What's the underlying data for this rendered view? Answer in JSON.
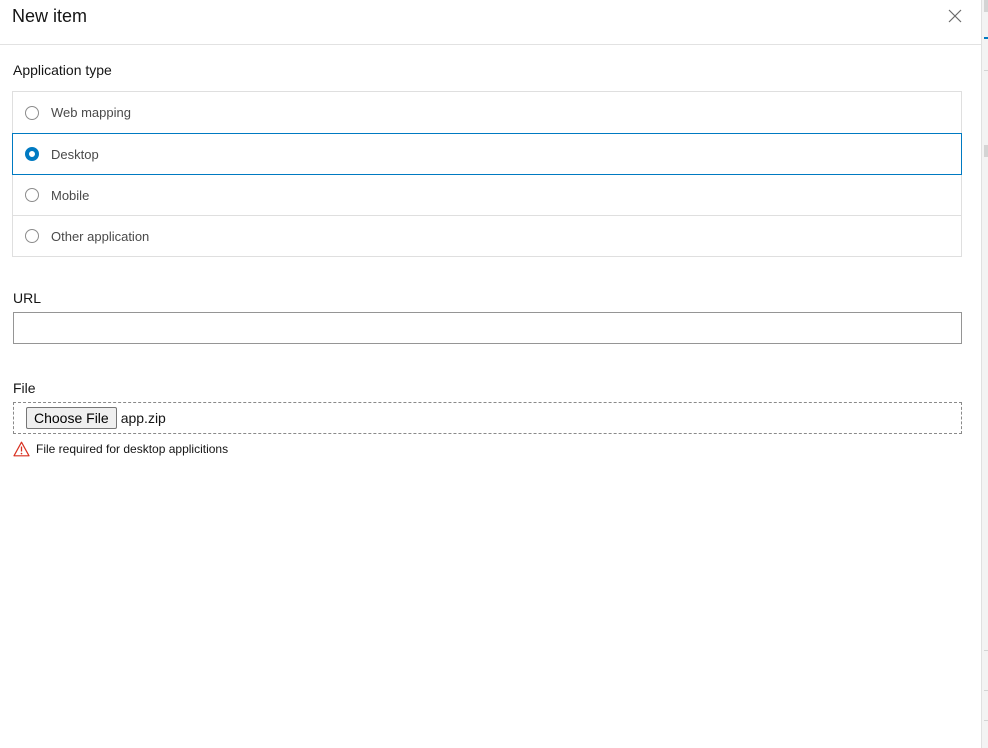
{
  "header": {
    "title": "New item"
  },
  "application_type": {
    "label": "Application type",
    "options": [
      {
        "label": "Web mapping",
        "selected": false
      },
      {
        "label": "Desktop",
        "selected": true
      },
      {
        "label": "Mobile",
        "selected": false
      },
      {
        "label": "Other application",
        "selected": false
      }
    ]
  },
  "url": {
    "label": "URL",
    "value": "",
    "placeholder": ""
  },
  "file": {
    "label": "File",
    "button_label": "Choose File",
    "file_name": "app.zip",
    "error": "File required for desktop applicitions"
  },
  "colors": {
    "accent": "#007ac2",
    "error": "#d83020"
  },
  "icons": {
    "close": "close-icon",
    "error": "warning-triangle-icon"
  }
}
